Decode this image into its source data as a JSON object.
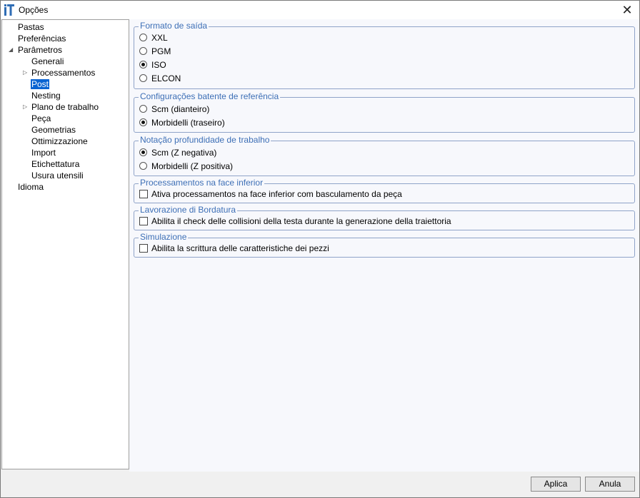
{
  "window": {
    "title": "Opções",
    "app_icon": "iT-logo",
    "close_glyph": "✕"
  },
  "tree": [
    {
      "label": "Pastas",
      "level": 0,
      "expander": ""
    },
    {
      "label": "Preferências",
      "level": 0,
      "expander": ""
    },
    {
      "label": "Parâmetros",
      "level": 0,
      "expander": "expanded"
    },
    {
      "label": "Generali",
      "level": 1,
      "expander": ""
    },
    {
      "label": "Processamentos",
      "level": 1,
      "expander": "collapsed"
    },
    {
      "label": "Post",
      "level": 1,
      "expander": "",
      "selected": true
    },
    {
      "label": "Nesting",
      "level": 1,
      "expander": ""
    },
    {
      "label": "Plano de trabalho",
      "level": 1,
      "expander": "collapsed"
    },
    {
      "label": "Peça",
      "level": 1,
      "expander": ""
    },
    {
      "label": "Geometrias",
      "level": 1,
      "expander": ""
    },
    {
      "label": "Ottimizzazione",
      "level": 1,
      "expander": ""
    },
    {
      "label": "Import",
      "level": 1,
      "expander": ""
    },
    {
      "label": "Etichettatura",
      "level": 1,
      "expander": ""
    },
    {
      "label": "Usura utensili",
      "level": 1,
      "expander": ""
    },
    {
      "label": "Idioma",
      "level": 0,
      "expander": ""
    }
  ],
  "groups": {
    "output_format": {
      "title": "Formato de saída",
      "options": [
        {
          "label": "XXL",
          "checked": false
        },
        {
          "label": "PGM",
          "checked": false
        },
        {
          "label": "ISO",
          "checked": true
        },
        {
          "label": "ELCON",
          "checked": false
        }
      ]
    },
    "reference_stop": {
      "title": "Configurações batente de referência",
      "options": [
        {
          "label": "Scm (dianteiro)",
          "checked": false
        },
        {
          "label": "Morbidelli (traseiro)",
          "checked": true
        }
      ]
    },
    "depth_notation": {
      "title": "Notação profundidade de trabalho",
      "options": [
        {
          "label": "Scm (Z negativa)",
          "checked": true
        },
        {
          "label": "Morbidelli (Z positiva)",
          "checked": false
        }
      ]
    },
    "lower_face": {
      "title": "Processamentos na face inferior",
      "checkbox_label": "Ativa processamentos na face inferior com basculamento da peça",
      "checked": false
    },
    "edging": {
      "title": "Lavorazione di Bordatura",
      "checkbox_label": "Abilita il check delle collisioni della testa durante la generazione della traiettoria",
      "checked": false
    },
    "simulation": {
      "title": "Simulazione",
      "checkbox_label": "Abilita la scrittura delle caratteristiche dei pezzi",
      "checked": false
    }
  },
  "buttons": {
    "apply": "Aplica",
    "cancel": "Anula"
  }
}
